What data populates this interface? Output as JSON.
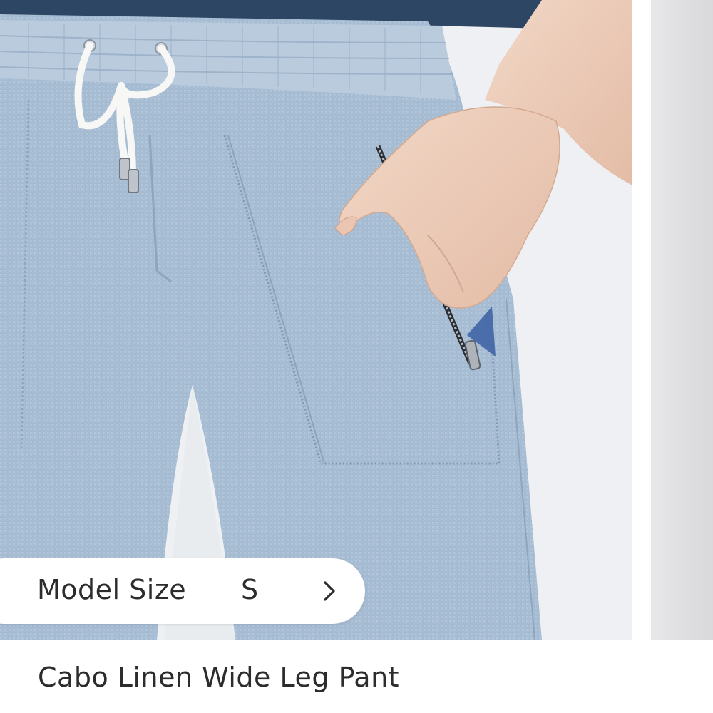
{
  "product": {
    "title": "Cabo Linen Wide Leg Pant"
  },
  "model_size": {
    "label": "Model Size",
    "value": "S",
    "icon": "chevron-right-icon"
  },
  "colors": {
    "linen_blue": "#a9bfd6",
    "background": "#ffffff",
    "text": "#2c2c2c"
  }
}
